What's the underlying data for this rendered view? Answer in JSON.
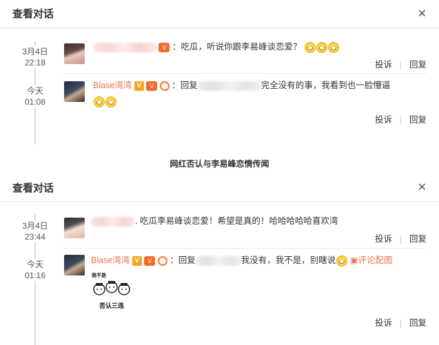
{
  "caption": "网红否认与李易峰恋情传闻",
  "panels": [
    {
      "title": "查看对话",
      "close": "✕",
      "messages": [
        {
          "date": "3月4日",
          "time": "22:18",
          "text": "：吃瓜，听说你跟李易峰谈恋爱？",
          "report": "投诉",
          "reply": "回复"
        },
        {
          "date": "今天",
          "time": "01:08",
          "author": "Blase湾湾",
          "reply_prefix": "：回复",
          "text": "完全没有的事，我看到也一脸懵逼",
          "report": "投诉",
          "reply": "回复"
        }
      ]
    },
    {
      "title": "查看对话",
      "close": "✕",
      "messages": [
        {
          "date": "3月4日",
          "time": "23:44",
          "text": ". 吃瓜李易峰谈恋爱！希望是真的！哈哈哈哈哈喜欢湾",
          "report": "投诉",
          "reply": "回复"
        },
        {
          "date": "今天",
          "time": "01:16",
          "author": "Blase湾湾",
          "reply_prefix": "：回复",
          "text": "我没有，我不是，别瞎说",
          "image_link": "评论配图",
          "meme_caption": "否认三连",
          "meme_top": "我不是",
          "report": "投诉",
          "reply": "回复"
        }
      ]
    }
  ],
  "icons": {
    "close": "close-icon",
    "verified": "verified-v-icon",
    "vip": "vip-badge-icon",
    "emoji": "grin-emoji-icon",
    "image": "image-icon"
  },
  "colors": {
    "accent": "#eb7350",
    "text": "#333333",
    "divider": "#e6e6e6"
  }
}
